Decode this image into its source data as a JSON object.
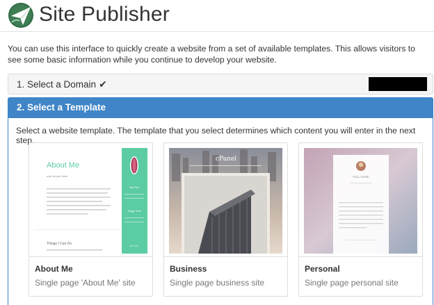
{
  "header": {
    "title": "Site Publisher",
    "logo_icon": "paper-plane-icon"
  },
  "intro": "You can use this interface to quickly create a website from a set of available templates. This allows visitors to see some basic information while you continue to develop your website.",
  "steps": [
    {
      "label": "1. Select a Domain",
      "state": "complete",
      "icon": "check-icon"
    },
    {
      "label": "2. Select a Template",
      "state": "active"
    }
  ],
  "templates_desc": "Select a website template. The template that you select determines which content you will enter in the next step.",
  "templates": [
    {
      "title": "About Me",
      "subtitle": "Single page 'About Me' site",
      "preview": {
        "heading": "About Me",
        "subheading": "who do you think",
        "section2": "Things I Can Do",
        "panel_name": "Ted Ten",
        "panel_contact": "Things To Do",
        "panel_footer": "a  t  l  i  b"
      }
    },
    {
      "title": "Business",
      "subtitle": "Single page business site",
      "preview": {
        "brand": "cPanel"
      }
    },
    {
      "title": "Personal",
      "subtitle": "Single page personal site",
      "preview": {
        "name": "FULL NAME"
      }
    }
  ],
  "colors": {
    "accent": "#3f85c7",
    "teal": "#5ccca3",
    "text": "#333333",
    "muted": "#777777"
  }
}
